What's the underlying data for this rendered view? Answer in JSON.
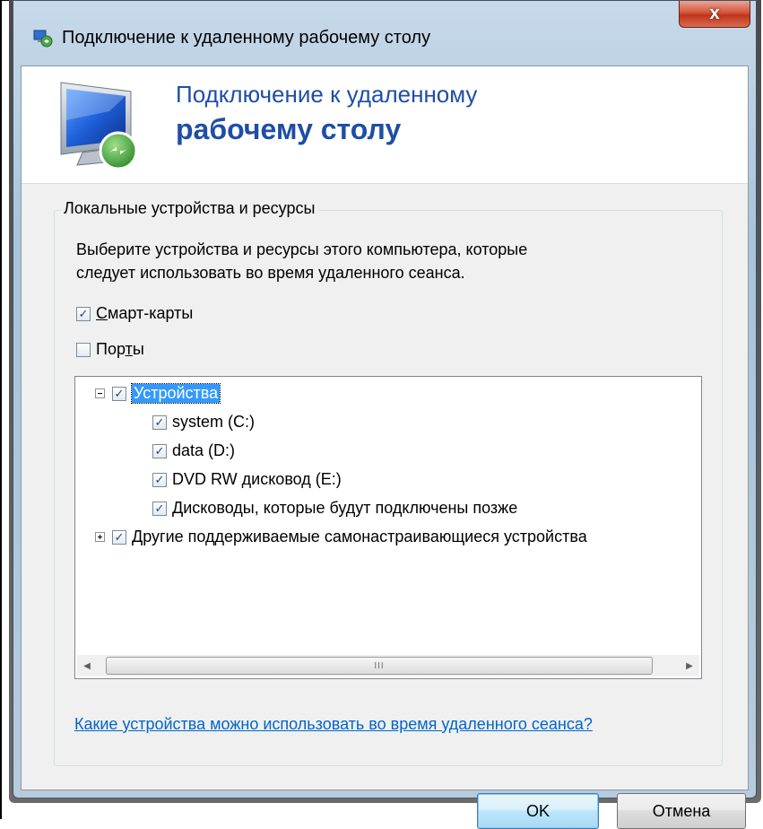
{
  "window": {
    "title": "Подключение к удаленному рабочему столу",
    "close_label": "x"
  },
  "header": {
    "line1": "Подключение к удаленному",
    "line2": "рабочему столу"
  },
  "group": {
    "label": "Локальные устройства и ресурсы",
    "description_line1": "Выберите устройства и ресурсы этого компьютера, которые",
    "description_line2": "следует использовать во время удаленного сеанса.",
    "smartcards": {
      "label_pre": "",
      "label_u": "С",
      "label_post": "март-карты",
      "checked": true
    },
    "ports": {
      "label_pre": "Пор",
      "label_u": "т",
      "label_post": "ы",
      "checked": false
    }
  },
  "tree": {
    "root": {
      "label": "Устройства",
      "checked": true,
      "expanded": true
    },
    "children": [
      {
        "label": "system (C:)",
        "checked": true
      },
      {
        "label": "data (D:)",
        "checked": true
      },
      {
        "label": "DVD RW дисковод (E:)",
        "checked": true
      },
      {
        "label": "Дисководы, которые будут подключены позже",
        "checked": true
      }
    ],
    "other": {
      "label": "Другие поддерживаемые самонастраивающиеся устройства",
      "checked": true,
      "expanded": false
    },
    "scroll_thumb_grip": "III"
  },
  "help_link": "Какие устройства можно использовать во время удаленного сеанса?",
  "buttons": {
    "ok": "OK",
    "cancel": "Отмена"
  },
  "colors": {
    "accent": "#1e4ea6",
    "link": "#0066cc",
    "selection": "#3399ff",
    "close": "#c0351c"
  },
  "check_glyph": "✓"
}
